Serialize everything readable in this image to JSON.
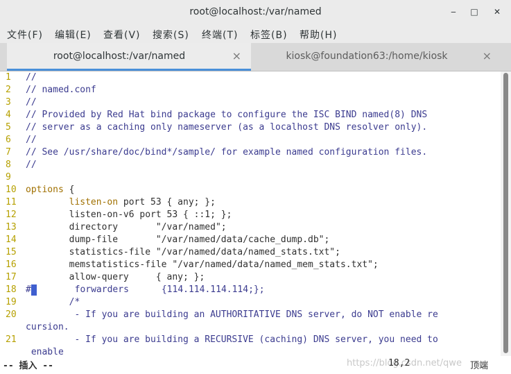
{
  "window": {
    "title": "root@localhost:/var/named",
    "minimize_icon": "minimize-icon",
    "maximize_icon": "maximize-icon",
    "close_icon": "close-icon"
  },
  "menu": [
    "文件(F)",
    "编辑(E)",
    "查看(V)",
    "搜索(S)",
    "终端(T)",
    "标签(B)",
    "帮助(H)"
  ],
  "tabs": [
    {
      "label": "root@localhost:/var/named",
      "close": "×"
    },
    {
      "label": "kiosk@foundation63:/home/kiosk",
      "close": "×"
    }
  ],
  "lines": [
    {
      "n": "1",
      "t": "//"
    },
    {
      "n": "2",
      "t": "// named.conf"
    },
    {
      "n": "3",
      "t": "//"
    },
    {
      "n": "4",
      "t": "// Provided by Red Hat bind package to configure the ISC BIND named(8) DNS"
    },
    {
      "n": "5",
      "t": "// server as a caching only nameserver (as a localhost DNS resolver only)."
    },
    {
      "n": "6",
      "t": "//"
    },
    {
      "n": "7",
      "t": "// See /usr/share/doc/bind*/sample/ for example named configuration files."
    },
    {
      "n": "8",
      "t": "//"
    },
    {
      "n": "9",
      "t": ""
    },
    {
      "n": "10",
      "kw": "options",
      "rest": " {"
    },
    {
      "n": "11",
      "indent": "        ",
      "kw": "listen-on",
      "rest": " port 53 { any; };"
    },
    {
      "n": "12",
      "indent": "        ",
      "rest": "listen-on-v6 port 53 { ::1; };"
    },
    {
      "n": "13",
      "indent": "        ",
      "rest": "directory       \"/var/named\";"
    },
    {
      "n": "14",
      "indent": "        ",
      "rest": "dump-file       \"/var/named/data/cache_dump.db\";"
    },
    {
      "n": "15",
      "indent": "        ",
      "rest": "statistics-file \"/var/named/data/named_stats.txt\";"
    },
    {
      "n": "16",
      "indent": "        ",
      "rest": "memstatistics-file \"/var/named/data/named_mem_stats.txt\";"
    },
    {
      "n": "17",
      "indent": "        ",
      "rest": "allow-query     { any; };"
    },
    {
      "n": "18",
      "prefix": "#",
      "indent": "       ",
      "blue": "forwarders      {114.114.114.114;};"
    },
    {
      "n": "19",
      "indent": "        ",
      "blue": "/*"
    },
    {
      "n": "20",
      "blue": "         - If you are building an AUTHORITATIVE DNS server, do NOT enable re"
    },
    {
      "n": "",
      "blue": "cursion."
    },
    {
      "n": "21",
      "blue": "         - If you are building a RECURSIVE (caching) DNS server, you need to"
    },
    {
      "n": "",
      "blue": " enable"
    }
  ],
  "status": {
    "mode": "-- 插入 --",
    "position": "18,2",
    "scroll": "顶端",
    "watermark": "https://blog.csdn.net/qwe"
  }
}
